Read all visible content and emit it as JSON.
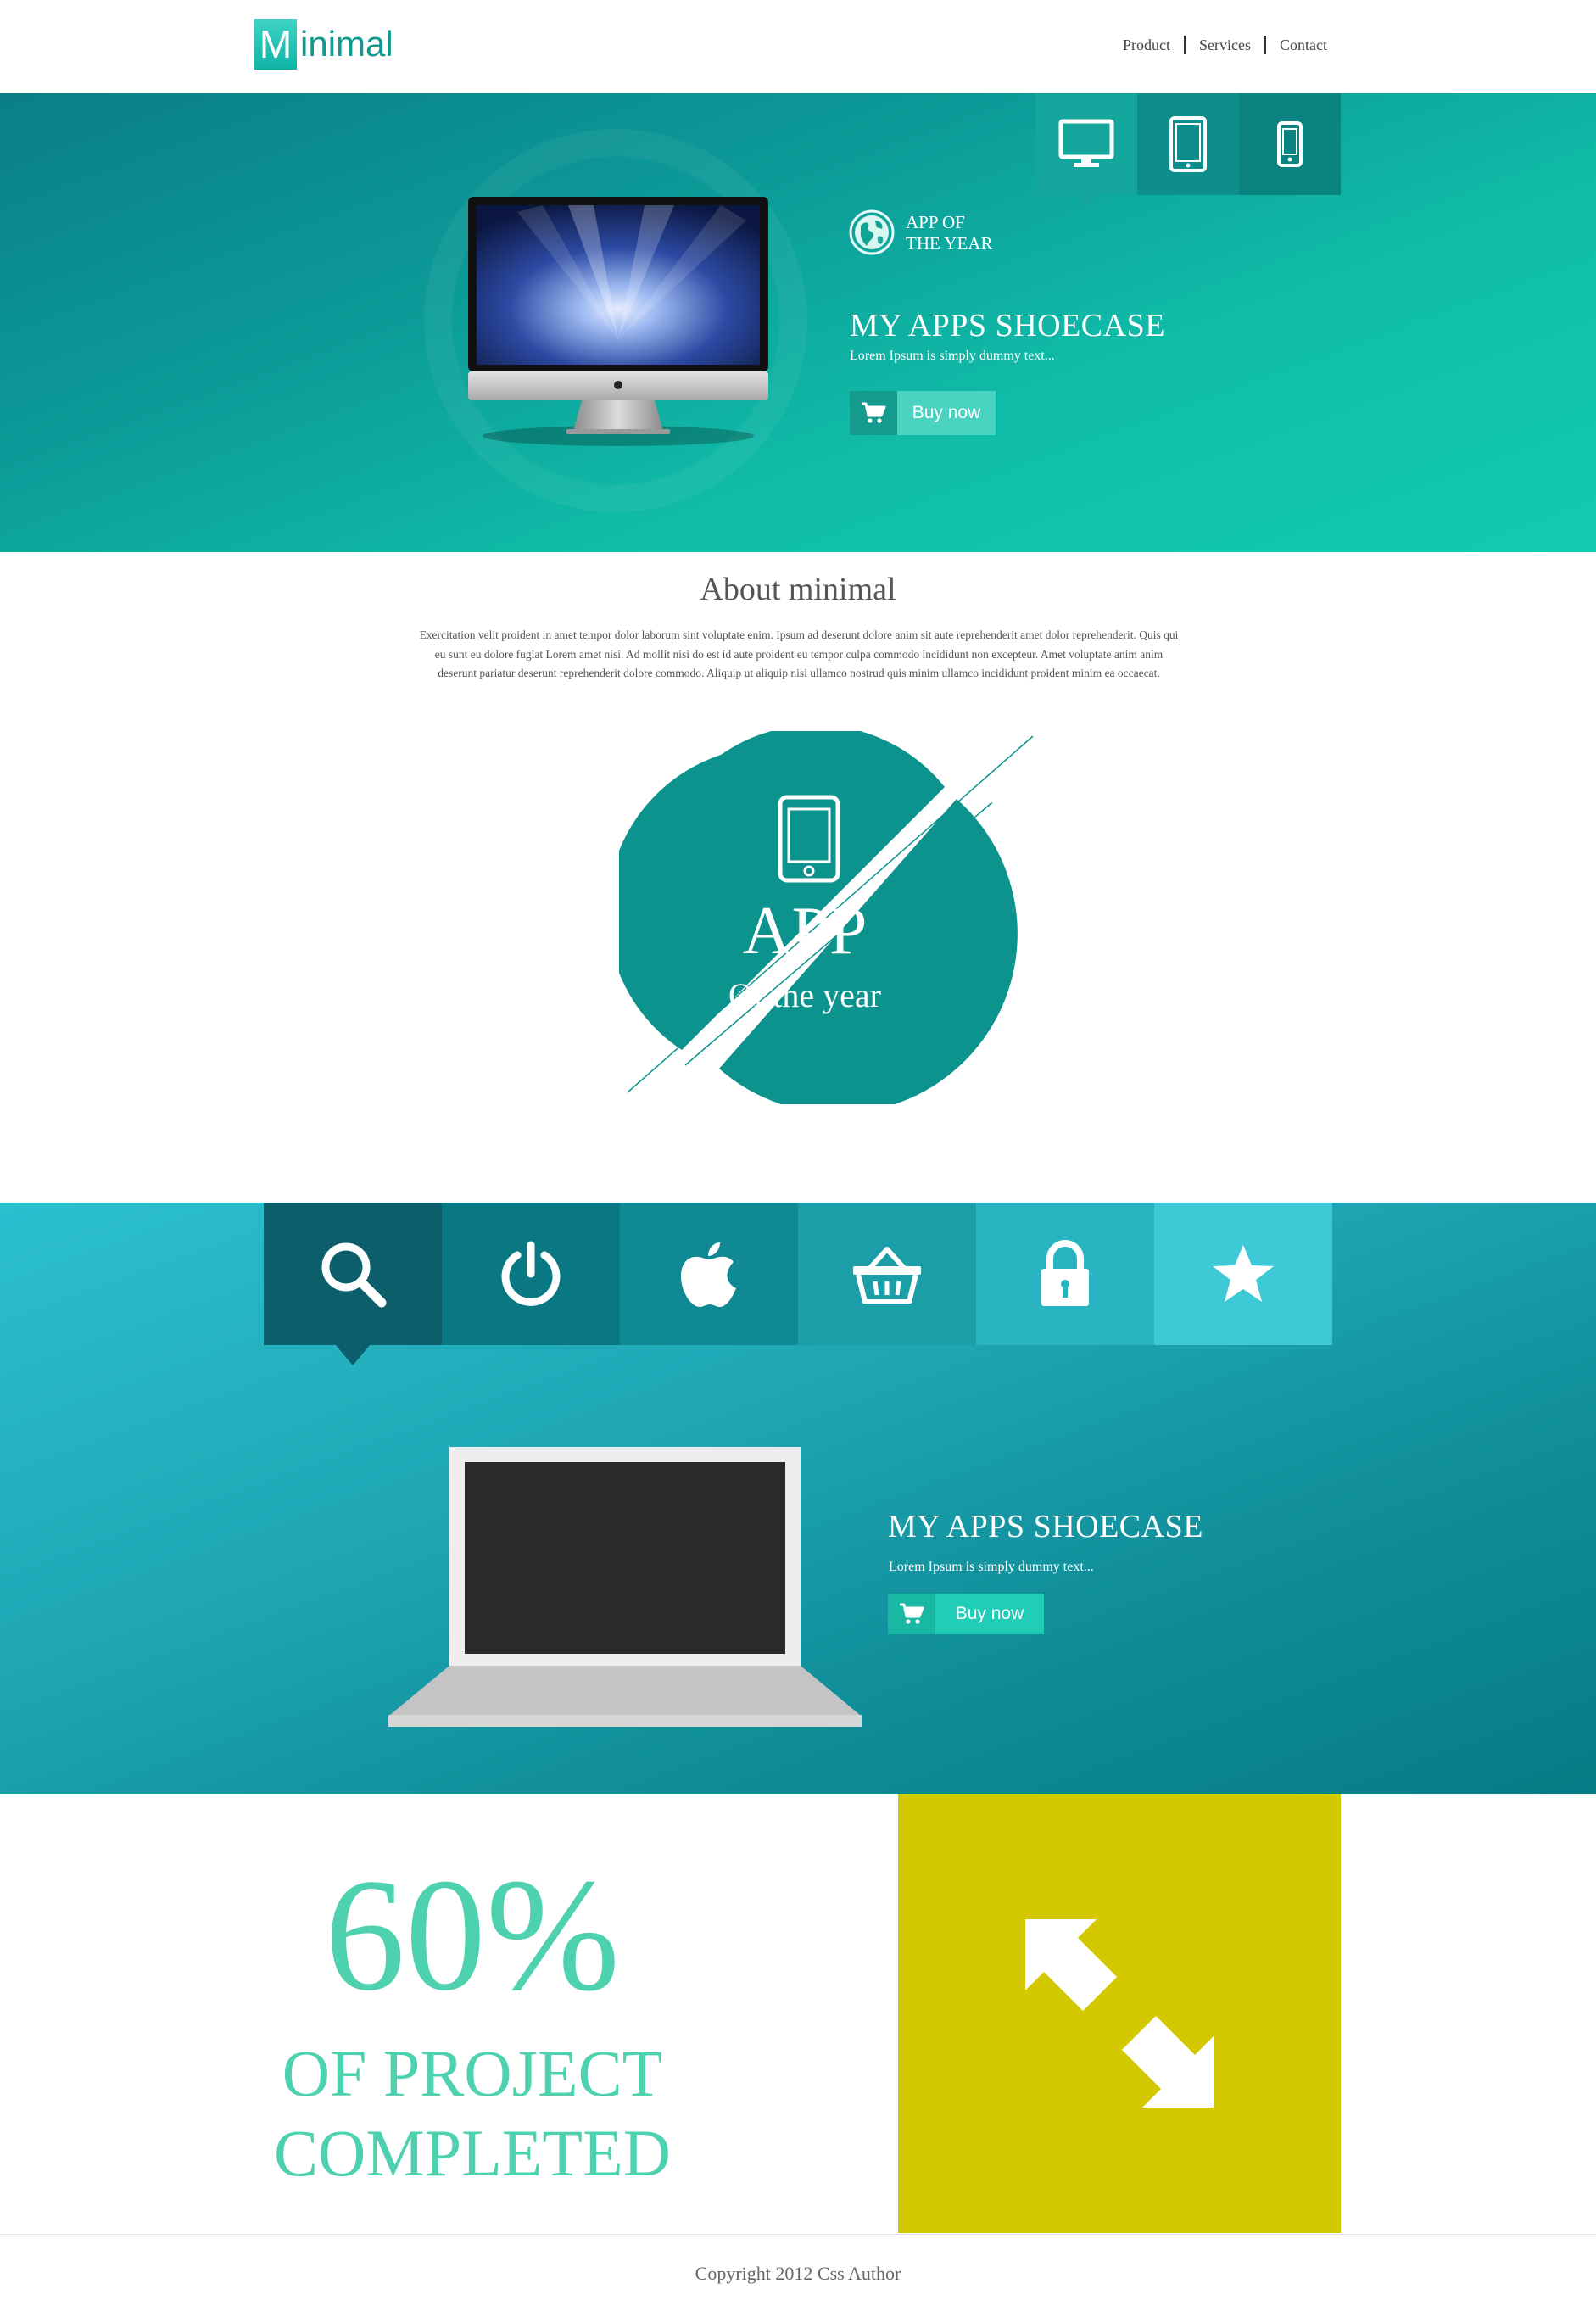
{
  "header": {
    "logo_initial": "M",
    "logo_rest": "inimal",
    "nav": [
      "Product",
      "Services",
      "Contact"
    ]
  },
  "hero": {
    "device_tabs": [
      "desktop-icon",
      "tablet-icon",
      "phone-icon"
    ],
    "award_label": "APP OF THE YEAR",
    "title": "MY APPS SHOECASE",
    "subtitle": "Lorem Ipsum is simply dummy text...",
    "buy_label": "Buy now"
  },
  "about": {
    "title": "About minimal",
    "text": "Exercitation velit proident in amet tempor dolor laborum sint voluptate enim. Ipsum ad deserunt dolore anim sit aute reprehenderit amet dolor reprehenderit. Quis qui eu sunt eu dolore fugiat Lorem amet nisi. Ad mollit nisi do est id aute proident eu tempor culpa commodo incididunt non excepteur. Amet voluptate anim anim deserunt pariatur deserunt reprehenderit dolore commodo. Aliquip ut aliquip nisi ullamco nostrud quis minim ullamco incididunt proident minim ea occaecat."
  },
  "badge": {
    "big": "APP",
    "small": "Of the year"
  },
  "features": {
    "tabs": [
      "search-icon",
      "power-icon",
      "apple-icon",
      "basket-icon",
      "lock-icon",
      "star-icon"
    ],
    "title": "MY APPS SHOECASE",
    "subtitle": "Lorem Ipsum is simply dummy text...",
    "buy_label": "Buy now"
  },
  "progress": {
    "value": "60%",
    "caption_line1": "OF PROJECT",
    "caption_line2": "COMPLETED"
  },
  "footer": {
    "copyright": "Copyright 2012 Css Author"
  },
  "colors": {
    "teal_dark": "#0a7e86",
    "teal_light": "#13cbb2",
    "accent_mint": "#4dd1ae",
    "mustard": "#d4c800"
  }
}
